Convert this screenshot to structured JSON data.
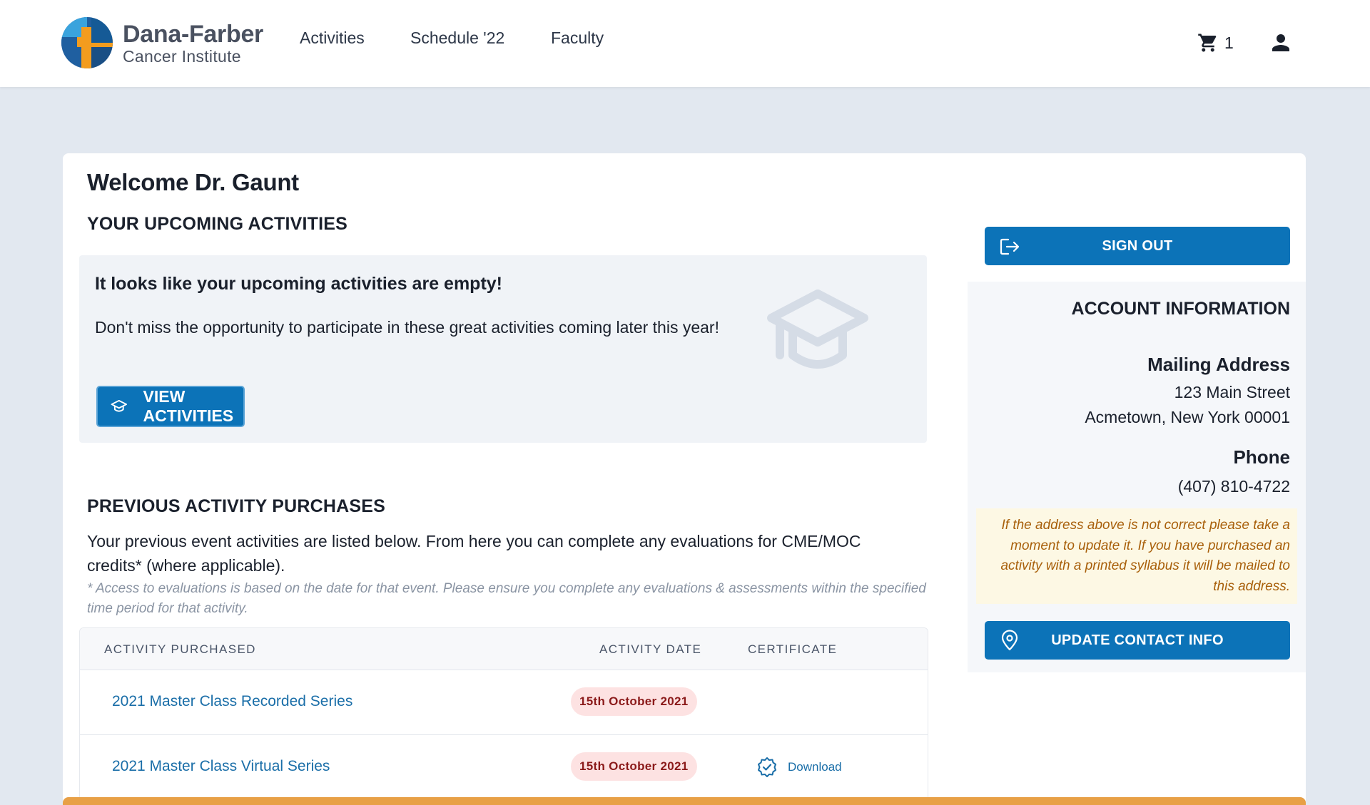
{
  "header": {
    "logo_title": "Dana-Farber",
    "logo_subtitle": "Cancer Institute",
    "nav": [
      "Activities",
      "Schedule '22",
      "Faculty"
    ],
    "cart_count": "1",
    "icons": {
      "cart": "shopping-cart-icon",
      "user": "user-icon"
    }
  },
  "main": {
    "welcome": "Welcome Dr. Gaunt",
    "upcoming_heading": "YOUR UPCOMING ACTIVITIES",
    "empty_title": "It looks like your upcoming activities are empty!",
    "empty_text": "Don't miss the opportunity to participate in these great activities coming later this year!",
    "view_activities_label": "VIEW ACTIVITIES",
    "previous_heading": "PREVIOUS ACTIVITY PURCHASES",
    "previous_text": "Your previous event activities are listed below. From here you can complete any evaluations for CME/MOC credits* (where applicable).",
    "previous_note": "* Access to evaluations is based on the date for that event. Please ensure you complete any evaluations & assessments within the specified time period for that activity.",
    "table": {
      "headers": [
        "ACTIVITY PURCHASED",
        "ACTIVITY DATE",
        "CERTIFICATE"
      ],
      "rows": [
        {
          "activity": "2021 Master Class Recorded Series",
          "date": "15th October 2021",
          "certificate": ""
        },
        {
          "activity": "2021 Master Class Virtual Series",
          "date": "15th October 2021",
          "certificate": "Download"
        }
      ]
    }
  },
  "sidebar": {
    "sign_out_label": "SIGN OUT",
    "account_title": "ACCOUNT INFORMATION",
    "mailing_label": "Mailing Address",
    "address_line1": "123 Main Street",
    "address_line2": "Acmetown, New York 00001",
    "phone_label": "Phone",
    "phone": "(407) 810-4722",
    "warning": "If the address above is not correct please take a moment to update it. If you have purchased an activity with a printed syllabus it will be mailed to this address.",
    "update_label": "UPDATE CONTACT INFO"
  },
  "colors": {
    "primary": "#0c73b8",
    "link": "#1a6ea8",
    "page_bg": "#e2e8f0",
    "badge_bg": "#fde2e2",
    "badge_text": "#8b1a1a",
    "warning_text": "#a85f0a",
    "accent_bar": "#e8a046"
  }
}
